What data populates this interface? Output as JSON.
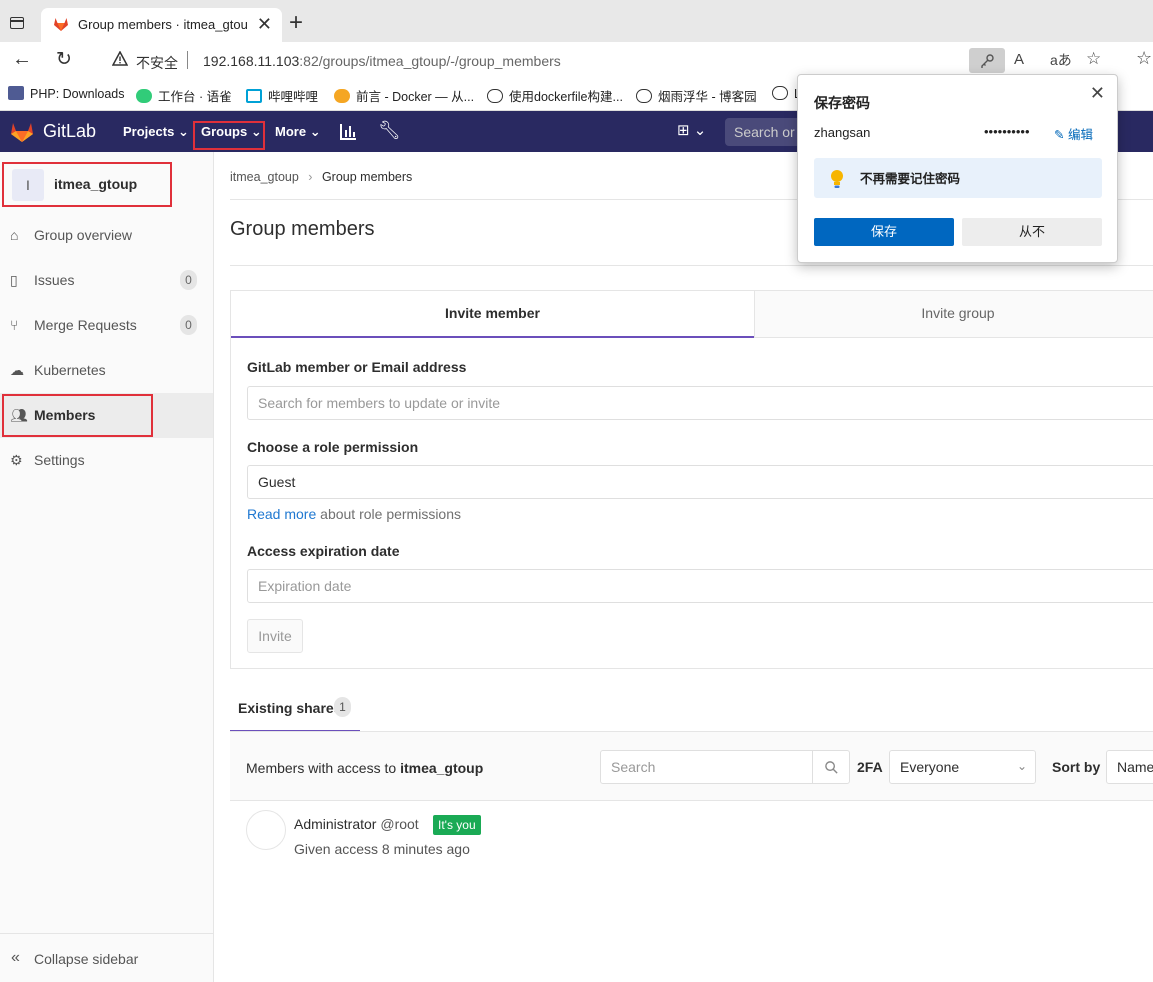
{
  "browser": {
    "tab_title": "Group members · itmea_gtoup · GitLab",
    "insecure_label": "不安全",
    "url_host": "192.168.11.103",
    "url_rest": ":82/groups/itmea_gtoup/-/group_members",
    "bookmarks": [
      "PHP: Downloads",
      "工作台 · 语雀",
      "哔哩哔哩",
      "前言 - Docker — 从...",
      "使用dockerfile构建...",
      "烟雨浮华 - 博客园",
      "L"
    ]
  },
  "header": {
    "brand": "GitLab",
    "nav": [
      "Projects",
      "Groups",
      "More"
    ],
    "search_placeholder": "Search or jump to…"
  },
  "sidebar": {
    "group_initial": "I",
    "group_name": "itmea_gtoup",
    "items": [
      {
        "label": "Group overview",
        "icon": "home-icon"
      },
      {
        "label": "Issues",
        "icon": "issues-icon",
        "count": "0"
      },
      {
        "label": "Merge Requests",
        "icon": "merge-request-icon",
        "count": "0"
      },
      {
        "label": "Kubernetes",
        "icon": "cloud-icon"
      },
      {
        "label": "Members",
        "icon": "users-icon"
      },
      {
        "label": "Settings",
        "icon": "gear-icon"
      }
    ],
    "collapse_label": "Collapse sidebar"
  },
  "main": {
    "breadcrumb": [
      "itmea_gtoup",
      "Group members"
    ],
    "title": "Group members",
    "tabs": [
      "Invite member",
      "Invite group"
    ],
    "member_label": "GitLab member or Email address",
    "member_placeholder": "Search for members to update or invite",
    "role_label": "Choose a role permission",
    "role_value": "Guest",
    "readmore_link": "Read more",
    "readmore_text": " about role permissions",
    "expiration_label": "Access expiration date",
    "expiration_placeholder": "Expiration date",
    "invite_button": "Invite",
    "shares_tab": "Existing shares",
    "shares_count": "1",
    "members_with_access": "Members with access to ",
    "group_bold": "itmea_gtoup",
    "search_placeholder": "Search",
    "twofa_label": "2FA",
    "filter_value": "Everyone",
    "sort_label": "Sort by",
    "sort_value": "Name"
  },
  "member": {
    "name": "Administrator",
    "username": "@root",
    "badge": "It's you",
    "access": "Given access 8 minutes ago"
  },
  "password_popup": {
    "title": "保存密码",
    "username": "zhangsan",
    "password_mask": "••••••••••",
    "edit_label": "编辑",
    "tip": "不再需要记住密码",
    "save_button": "保存",
    "never_button": "从不"
  },
  "colors": {
    "gitlab_header": "#292961",
    "highlight_red": "#e0303a",
    "active_tab": "#6b4fbb",
    "badge_green": "#1aaa55",
    "save_blue": "#0067c0"
  }
}
